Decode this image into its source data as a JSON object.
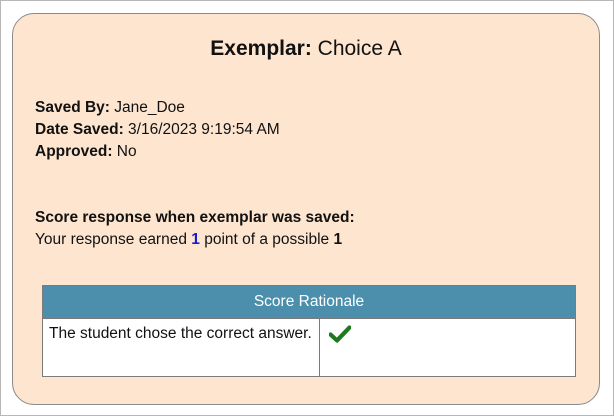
{
  "exemplar": {
    "title_strong": "Exemplar:",
    "title_rest": " Choice A"
  },
  "meta": {
    "saved_by_label": "Saved By:",
    "saved_by_value": " Jane_Doe",
    "date_saved_label": "Date Saved:",
    "date_saved_value": " 3/16/2023 9:19:54 AM",
    "approved_label": "Approved:",
    "approved_value": " No"
  },
  "score": {
    "heading": "Score response when exemplar was saved:",
    "prefix": "Your response earned ",
    "earned": "1",
    "middle": " point of a possible ",
    "possible": "1"
  },
  "rationale_table": {
    "header": "Score Rationale",
    "rows": [
      {
        "text": "The student chose the correct answer.",
        "icon": "checkmark-icon"
      }
    ]
  },
  "colors": {
    "card_background": "#fde5cf",
    "table_header": "#4b8fad",
    "earned_points": "#1a1ad6",
    "checkmark": "#1f7a1f"
  }
}
